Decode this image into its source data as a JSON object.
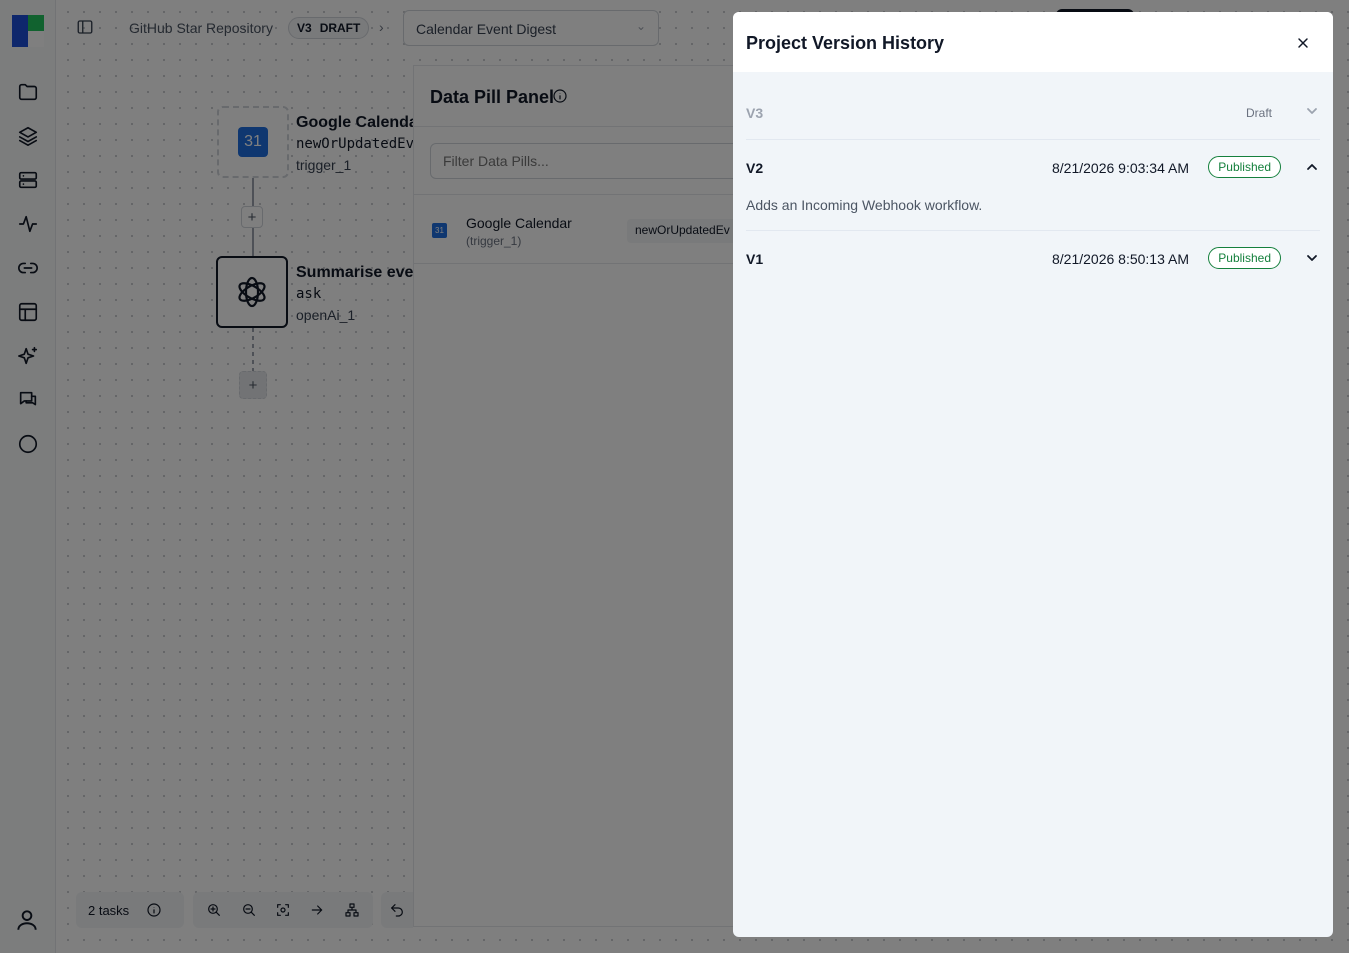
{
  "header": {
    "project_name": "GitHub Star Repository",
    "version_label": "V3",
    "version_status": "DRAFT",
    "breadcrumb_separator": "›",
    "workflow_name": "Calendar Event Digest"
  },
  "nodes": [
    {
      "title": "Google Calenda",
      "operation": "newOrUpdatedEv",
      "id": "trigger_1",
      "icon": "google-calendar-icon",
      "icon_text": "31"
    },
    {
      "title": "Summarise eve",
      "operation": "ask",
      "id": "openAi_1",
      "icon": "openai-icon"
    }
  ],
  "add_button_label": "+",
  "data_pill_panel": {
    "title": "Data Pill Panel",
    "filter_placeholder": "Filter Data Pills...",
    "items": [
      {
        "name": "Google Calendar",
        "ref": "(trigger_1)",
        "chip": "newOrUpdatedEv",
        "icon_text": "31"
      }
    ]
  },
  "footer": {
    "tasks_label": "2 tasks"
  },
  "modal": {
    "title": "Project Version History",
    "versions": [
      {
        "label": "V3",
        "status": "Draft",
        "expanded": false
      },
      {
        "label": "V2",
        "date": "8/21/2026 9:03:34 AM",
        "status": "Published",
        "expanded": true,
        "description": "Adds an Incoming Webhook workflow."
      },
      {
        "label": "V1",
        "date": "8/21/2026 8:50:13 AM",
        "status": "Published",
        "expanded": false
      }
    ]
  },
  "colors": {
    "published": "#15803d",
    "overlay": "rgba(0,0,0,0.5)",
    "calendar_blue": "#1e6fe0"
  }
}
